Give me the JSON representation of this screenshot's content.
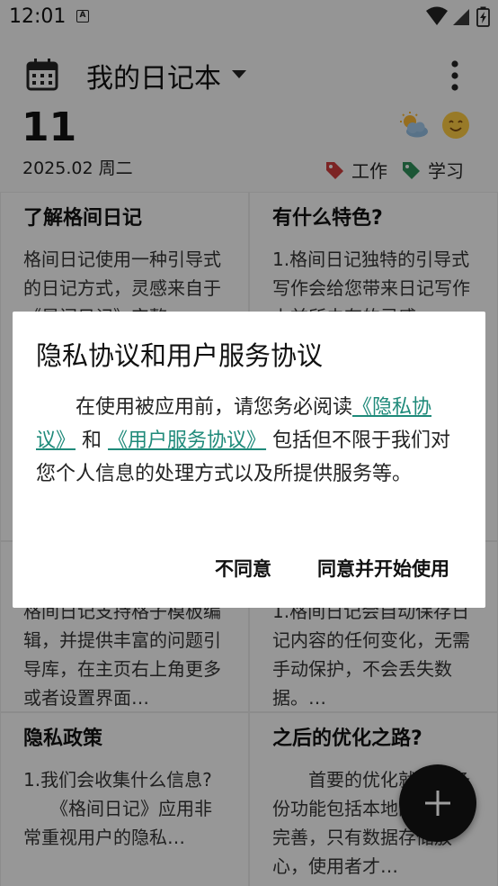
{
  "status_bar": {
    "time": "12:01",
    "notification_icon": "A"
  },
  "header": {
    "title": "我的日记本",
    "day": "11",
    "date": "2025.02 周二",
    "weather_icon": "partly-cloudy",
    "mood_icon": "smiling-face",
    "tags": [
      {
        "label": "工作",
        "color": "#c83a3a"
      },
      {
        "label": "学习",
        "color": "#2e8b57"
      }
    ]
  },
  "cards": [
    {
      "title": "了解格间日记",
      "body": " 格间日记使用一种引导式的日记方式，灵感来自于《晨间日记》完整…"
    },
    {
      "title": "有什么特色?",
      "body": "1.格间日记独特的引导式写作会给您带来日记写作上前所未有的灵感…"
    },
    {
      "title": "",
      "body": "格间日记支持格子模板编辑，并提供丰富的问题引导库，在主页右上角更多或者设置界面…"
    },
    {
      "title": "",
      "body": "1.格间日记会自动保存日记内容的任何变化，无需手动保护，不会丢失数据。…"
    },
    {
      "title": "隐私政策",
      "body": "1.我们会收集什么信息?\n　　《格间日记》应用非常重视用户的隐私…"
    },
    {
      "title": "之后的优化之路?",
      "body": "　　首要的优化就是云备份功能包括本地的备份做完善，只有数据存储放心，使用者才…"
    }
  ],
  "dialog": {
    "title": "隐私协议和用户服务协议",
    "body_prefix": "　　在使用被应用前，请您务必阅读",
    "privacy_link": "《隐私协议》",
    "and": "和",
    "service_link": "《用户服务协议》",
    "body_suffix": "包括但不限于我们对您个人信息的处理方式以及所提供服务等。",
    "disagree_label": "不同意",
    "agree_label": "同意并开始使用"
  },
  "fab": {
    "icon": "plus-icon"
  },
  "colors": {
    "link": "#1f8a7a",
    "fab": "#141414"
  }
}
